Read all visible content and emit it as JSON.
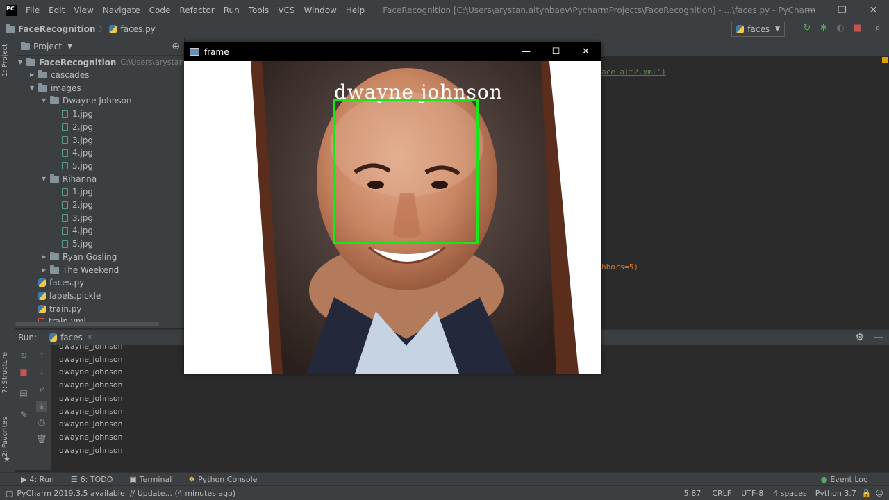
{
  "app": {
    "logo": "PC",
    "menu": [
      "File",
      "Edit",
      "View",
      "Navigate",
      "Code",
      "Refactor",
      "Run",
      "Tools",
      "VCS",
      "Window",
      "Help"
    ],
    "title": "FaceRecognition [C:\\Users\\arystan.altynbaev\\PycharmProjects\\FaceRecognition] - ...\\faces.py - PyCharm"
  },
  "breadcrumb": {
    "project": "FaceRecognition",
    "file": "faces.py"
  },
  "run_config": "faces",
  "left_tabs": {
    "project": "1: Project",
    "structure": "7: Structure",
    "favorites": "2: Favorites"
  },
  "project_panel": {
    "header": "Project",
    "root_name": "FaceRecognition",
    "root_path": "C:\\Users\\arystan.altynbaev",
    "items": [
      {
        "label": "cascades",
        "type": "folder",
        "level": 1,
        "arrow": "▶"
      },
      {
        "label": "images",
        "type": "folder",
        "level": 1,
        "arrow": "▼"
      },
      {
        "label": "Dwayne Johnson",
        "type": "folder",
        "level": 2,
        "arrow": "▼"
      },
      {
        "label": "1.jpg",
        "type": "file",
        "level": 3
      },
      {
        "label": "2.jpg",
        "type": "file",
        "level": 3
      },
      {
        "label": "3.jpg",
        "type": "file",
        "level": 3
      },
      {
        "label": "4.jpg",
        "type": "file",
        "level": 3
      },
      {
        "label": "5.jpg",
        "type": "file",
        "level": 3
      },
      {
        "label": "Rihanna",
        "type": "folder",
        "level": 2,
        "arrow": "▼"
      },
      {
        "label": "1.jpg",
        "type": "file",
        "level": 3
      },
      {
        "label": "2.jpg",
        "type": "file",
        "level": 3
      },
      {
        "label": "3.jpg",
        "type": "file",
        "level": 3
      },
      {
        "label": "4.jpg",
        "type": "file",
        "level": 3
      },
      {
        "label": "5.jpg",
        "type": "file",
        "level": 3
      },
      {
        "label": "Ryan Gosling",
        "type": "folder",
        "level": 2,
        "arrow": "▶"
      },
      {
        "label": "The Weekend",
        "type": "folder",
        "level": 2,
        "arrow": "▶"
      },
      {
        "label": "faces.py",
        "type": "py",
        "level": 1
      },
      {
        "label": "labels.pickle",
        "type": "py",
        "level": 1
      },
      {
        "label": "train.py",
        "type": "py",
        "level": 1
      },
      {
        "label": "train.yml",
        "type": "yml",
        "level": 1
      }
    ]
  },
  "editor": {
    "fragment1": "ace_alt2.xml')",
    "fragment2": "hbors=5)"
  },
  "run_panel": {
    "label": "Run:",
    "tab": "faces",
    "output": [
      "dwayne_johnson",
      "dwayne_johnson",
      "dwayne_johnson",
      "dwayne_johnson",
      "dwayne_johnson",
      "dwayne_johnson",
      "dwayne_johnson",
      "dwayne_johnson",
      "dwayne_johnson"
    ]
  },
  "bottom_tools": [
    "4: Run",
    "6: TODO",
    "Terminal",
    "Python Console"
  ],
  "event_log": "Event Log",
  "status": {
    "message": "PyCharm 2019.3.5 available: // Update... (4 minutes ago)",
    "position": "5:87",
    "line_sep": "CRLF",
    "encoding": "UTF-8",
    "indent": "4 spaces",
    "interpreter": "Python 3.7"
  },
  "cv_window": {
    "title": "frame",
    "label": "dwayne johnson",
    "box_color": "#19e619"
  }
}
